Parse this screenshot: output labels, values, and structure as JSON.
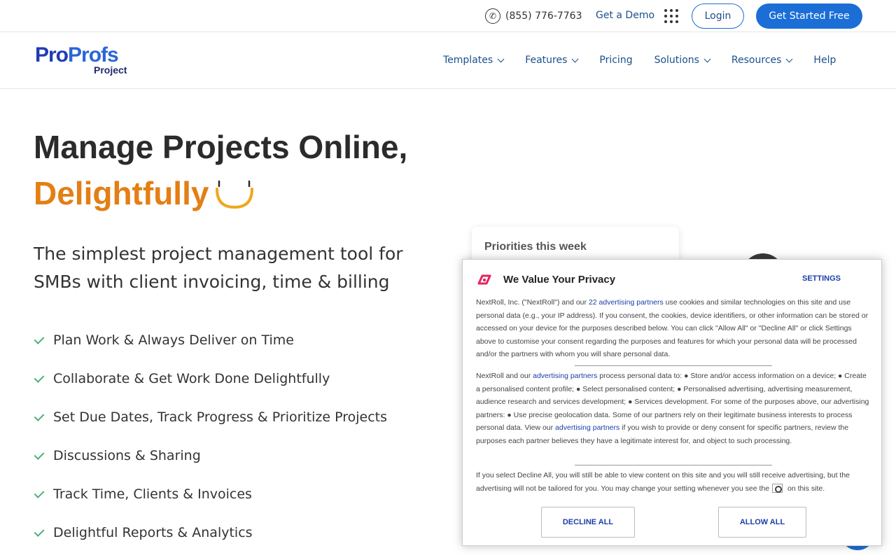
{
  "topbar": {
    "phone": "(855) 776-7763",
    "phone_icon": "phone-icon",
    "demo_label": "Get a Demo",
    "apps_icon": "grid-icon",
    "login_label": "Login",
    "start_label": "Get Started Free"
  },
  "brand": {
    "logo_part1": "Pro",
    "logo_part2": "Profs",
    "product": "Project"
  },
  "nav": {
    "items": [
      {
        "label": "Templates",
        "dropdown": true
      },
      {
        "label": "Features",
        "dropdown": true
      },
      {
        "label": "Pricing",
        "dropdown": false
      },
      {
        "label": "Solutions",
        "dropdown": true
      },
      {
        "label": "Resources",
        "dropdown": true
      },
      {
        "label": "Help",
        "dropdown": false
      }
    ]
  },
  "hero": {
    "title_line1": "Manage Projects Online,",
    "title_line2": "Delightfully",
    "subtitle": "The simplest project management tool for SMBs with client invoicing, time & billing",
    "features": [
      "Plan Work & Always Deliver on Time",
      "Collaborate & Get Work Done Delightfully",
      "Set Due Dates, Track Progress & Prioritize Projects",
      "Discussions & Sharing",
      "Track Time, Clients & Invoices",
      "Delightful Reports & Analytics"
    ]
  },
  "preview": {
    "card_title": "Priorities this week"
  },
  "consent": {
    "title": "We Value Your Privacy",
    "settings_label": "SETTINGS",
    "p1_pre": "NextRoll, Inc. (\"NextRoll\") and our ",
    "p1_link": "22 advertising partners",
    "p1_post": " use cookies and similar technologies on this site and use personal data (e.g., your IP address). If you consent, the cookies, device identifiers, or other information can be stored or accessed on your device for the purposes described below. You can click \"Allow All\" or \"Decline All\" or click Settings above to customise your consent regarding the purposes and features for which your personal data will be processed and/or the partners with whom you will share personal data.",
    "p2_pre": "NextRoll and our ",
    "p2_link1": "advertising partners",
    "p2_mid": " process personal data to: ● Store and/or access information on a device; ● Create a personalised content profile; ● Select personalised content; ● Personalised advertising, advertising measurement, audience research and services development; ● Services development. For some of the purposes above, our advertising partners: ● Use precise geolocation data. Some of our partners rely on their legitimate business interests to process personal data. View our ",
    "p2_link2": "advertising partners",
    "p2_post": " if you wish to provide or deny consent for specific partners, review the purposes each partner believes they have a legitimate interest for, and object to such processing.",
    "p3_pre": "If you select Decline All, you will still be able to view content on this site and you will still receive advertising, but the advertising will not be tailored for you. You may change your setting whenever you see the",
    "p3_post": " on this site.",
    "decline_label": "DECLINE ALL",
    "allow_label": "ALLOW ALL"
  },
  "colors": {
    "primary": "#1b6ed6",
    "nav_text": "#1b4f8c",
    "accent_orange": "#e37f14",
    "check_green": "#4caf7a"
  }
}
